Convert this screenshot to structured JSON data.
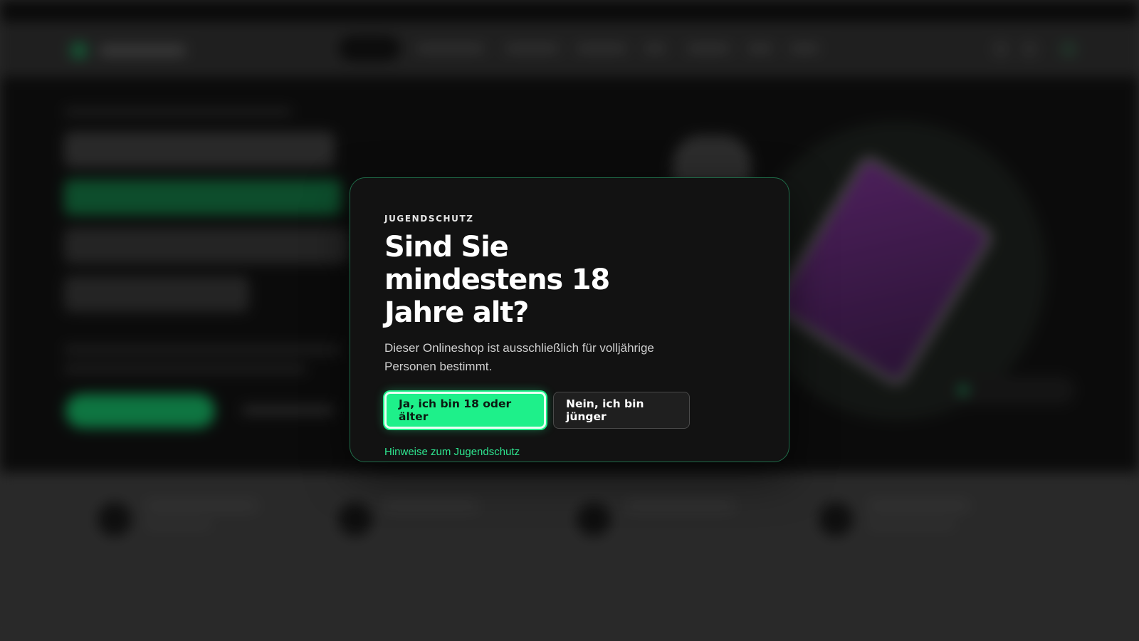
{
  "modal": {
    "eyebrow": "JUGENDSCHUTZ",
    "title": "Sind Sie mindestens 18 Jahre alt?",
    "description": "Dieser Onlineshop ist ausschließlich für volljährige Personen bestimmt.",
    "confirm_label": "Ja, ich bin 18 oder älter",
    "decline_label": "Nein, ich bin jünger",
    "help_link": "Hinweise zum Jugendschutz"
  },
  "colors": {
    "accent": "#1ef08a",
    "modal_bg": "#121212",
    "modal_border": "#1f6b48",
    "link": "#2ee58f"
  }
}
